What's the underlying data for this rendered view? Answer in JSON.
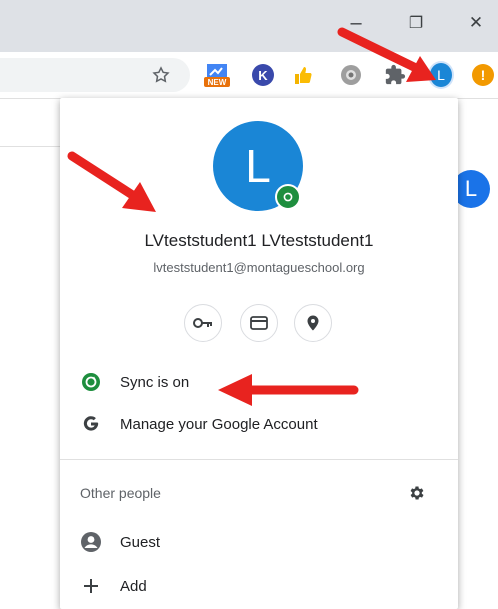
{
  "window": {
    "minimize_glyph": "–",
    "restore_glyph": "❐",
    "close_glyph": "✕"
  },
  "toolbar": {
    "extensions": [
      {
        "name": "new-extension-icon",
        "badge": "NEW"
      },
      {
        "name": "k-extension-icon",
        "letter": "K"
      },
      {
        "name": "thumbs-up-extension-icon"
      },
      {
        "name": "gray-extension-icon"
      },
      {
        "name": "puzzle-icon"
      },
      {
        "name": "profile-avatar-button",
        "letter": "L"
      },
      {
        "name": "update-alert-icon",
        "glyph": "!"
      }
    ]
  },
  "background_avatar_letter": "L",
  "profile": {
    "avatar_letter": "L",
    "name": "LVteststudent1 LVteststudent1",
    "email": "lvteststudent1@montagueschool.org"
  },
  "quick_actions": [
    "passwords-button",
    "payment-methods-button",
    "addresses-button"
  ],
  "menu": {
    "sync_label": "Sync is on",
    "manage_account_label": "Manage your Google Account"
  },
  "other_people": {
    "section_label": "Other people",
    "guest_label": "Guest",
    "add_label": "Add"
  },
  "colors": {
    "accent_blue": "#1a73e8",
    "sync_green": "#1e8e3e",
    "arrow_red": "#e8231f",
    "alert_orange": "#f29900"
  }
}
